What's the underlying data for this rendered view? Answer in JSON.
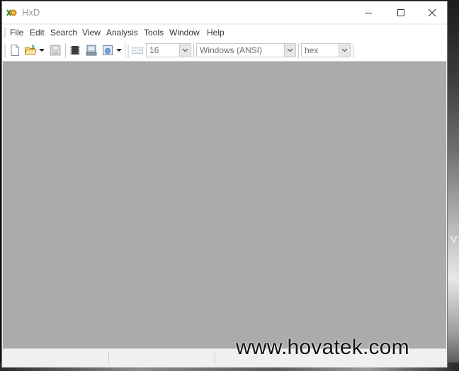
{
  "window": {
    "title": "HxD",
    "app_icon": "hxd-app-icon",
    "controls": {
      "minimize": "minimize-icon",
      "maximize": "maximize-icon",
      "close": "close-icon"
    }
  },
  "menu": {
    "items": [
      {
        "label": "File"
      },
      {
        "label": "Edit"
      },
      {
        "label": "Search"
      },
      {
        "label": "View"
      },
      {
        "label": "Analysis"
      },
      {
        "label": "Tools"
      },
      {
        "label": "Window"
      },
      {
        "label": "Help"
      }
    ]
  },
  "toolbar": {
    "icons": [
      "new-file-icon",
      "open-folder-icon",
      "save-icon",
      "ram-chip-icon",
      "open-disk-icon",
      "open-ram-icon"
    ],
    "bytes_per_row": "16",
    "charset": "Windows (ANSI)",
    "offset_base": "hex"
  },
  "watermark": "www.hovatek.com",
  "colors": {
    "workspace": "#ababab",
    "window_bg": "#f0f0f0",
    "title_text": "#9a9a9a"
  }
}
